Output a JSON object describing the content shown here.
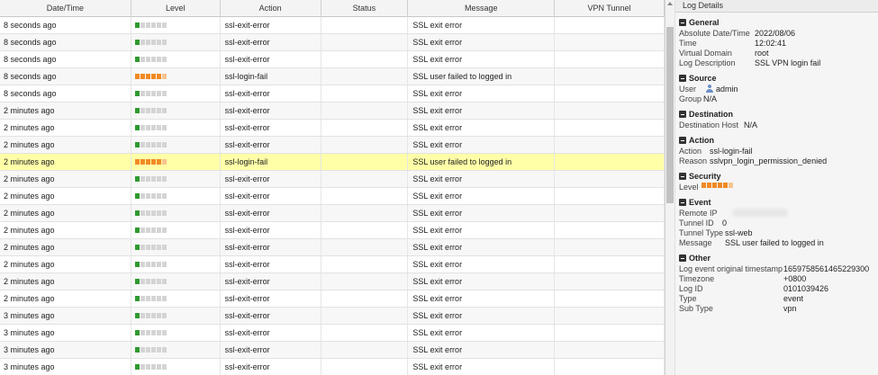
{
  "table": {
    "columns": [
      "Date/Time",
      "Level",
      "Action",
      "Status",
      "Message",
      "VPN Tunnel"
    ],
    "rows": [
      {
        "time": "8 seconds ago",
        "level": "info",
        "action": "ssl-exit-error",
        "status": "",
        "message": "SSL exit error",
        "tunnel": ""
      },
      {
        "time": "8 seconds ago",
        "level": "info",
        "action": "ssl-exit-error",
        "status": "",
        "message": "SSL exit error",
        "tunnel": ""
      },
      {
        "time": "8 seconds ago",
        "level": "info",
        "action": "ssl-exit-error",
        "status": "",
        "message": "SSL exit error",
        "tunnel": ""
      },
      {
        "time": "8 seconds ago",
        "level": "alert",
        "action": "ssl-login-fail",
        "status": "",
        "message": "SSL user failed to logged in",
        "tunnel": ""
      },
      {
        "time": "8 seconds ago",
        "level": "info",
        "action": "ssl-exit-error",
        "status": "",
        "message": "SSL exit error",
        "tunnel": ""
      },
      {
        "time": "2 minutes ago",
        "level": "info",
        "action": "ssl-exit-error",
        "status": "",
        "message": "SSL exit error",
        "tunnel": ""
      },
      {
        "time": "2 minutes ago",
        "level": "info",
        "action": "ssl-exit-error",
        "status": "",
        "message": "SSL exit error",
        "tunnel": ""
      },
      {
        "time": "2 minutes ago",
        "level": "info",
        "action": "ssl-exit-error",
        "status": "",
        "message": "SSL exit error",
        "tunnel": ""
      },
      {
        "time": "2 minutes ago",
        "level": "alert",
        "action": "ssl-login-fail",
        "status": "",
        "message": "SSL user failed to logged in",
        "tunnel": "",
        "selected": true
      },
      {
        "time": "2 minutes ago",
        "level": "info",
        "action": "ssl-exit-error",
        "status": "",
        "message": "SSL exit error",
        "tunnel": ""
      },
      {
        "time": "2 minutes ago",
        "level": "info",
        "action": "ssl-exit-error",
        "status": "",
        "message": "SSL exit error",
        "tunnel": ""
      },
      {
        "time": "2 minutes ago",
        "level": "info",
        "action": "ssl-exit-error",
        "status": "",
        "message": "SSL exit error",
        "tunnel": ""
      },
      {
        "time": "2 minutes ago",
        "level": "info",
        "action": "ssl-exit-error",
        "status": "",
        "message": "SSL exit error",
        "tunnel": ""
      },
      {
        "time": "2 minutes ago",
        "level": "info",
        "action": "ssl-exit-error",
        "status": "",
        "message": "SSL exit error",
        "tunnel": ""
      },
      {
        "time": "2 minutes ago",
        "level": "info",
        "action": "ssl-exit-error",
        "status": "",
        "message": "SSL exit error",
        "tunnel": ""
      },
      {
        "time": "2 minutes ago",
        "level": "info",
        "action": "ssl-exit-error",
        "status": "",
        "message": "SSL exit error",
        "tunnel": ""
      },
      {
        "time": "2 minutes ago",
        "level": "info",
        "action": "ssl-exit-error",
        "status": "",
        "message": "SSL exit error",
        "tunnel": ""
      },
      {
        "time": "3 minutes ago",
        "level": "info",
        "action": "ssl-exit-error",
        "status": "",
        "message": "SSL exit error",
        "tunnel": ""
      },
      {
        "time": "3 minutes ago",
        "level": "info",
        "action": "ssl-exit-error",
        "status": "",
        "message": "SSL exit error",
        "tunnel": ""
      },
      {
        "time": "3 minutes ago",
        "level": "info",
        "action": "ssl-exit-error",
        "status": "",
        "message": "SSL exit error",
        "tunnel": ""
      },
      {
        "time": "3 minutes ago",
        "level": "info",
        "action": "ssl-exit-error",
        "status": "",
        "message": "SSL exit error",
        "tunnel": ""
      }
    ]
  },
  "details": {
    "title": "Log Details",
    "general": {
      "heading": "General",
      "absolute_date_time_label": "Absolute Date/Time",
      "absolute_date_time": "2022/08/06",
      "time_label": "Time",
      "time": "12:02:41",
      "virtual_domain_label": "Virtual Domain",
      "virtual_domain": "root",
      "log_description_label": "Log Description",
      "log_description": "SSL VPN login fail"
    },
    "source": {
      "heading": "Source",
      "user_label": "User",
      "user": "admin",
      "group_label": "Group",
      "group": "N/A"
    },
    "destination": {
      "heading": "Destination",
      "host_label": "Destination Host",
      "host": "N/A"
    },
    "action": {
      "heading": "Action",
      "action_label": "Action",
      "action": "ssl-login-fail",
      "reason_label": "Reason",
      "reason": "sslvpn_login_permission_denied"
    },
    "security": {
      "heading": "Security",
      "level_label": "Level",
      "level": "alert"
    },
    "event": {
      "heading": "Event",
      "remote_ip_label": "Remote IP",
      "tunnel_id_label": "Tunnel ID",
      "tunnel_id": "0",
      "tunnel_type_label": "Tunnel Type",
      "tunnel_type": "ssl-web",
      "message_label": "Message",
      "message": "SSL user failed to logged in"
    },
    "other": {
      "heading": "Other",
      "orig_ts_label": "Log event original timestamp",
      "orig_ts": "1659758561465229300",
      "timezone_label": "Timezone",
      "timezone": "+0800",
      "log_id_label": "Log ID",
      "log_id": "0101039426",
      "type_label": "Type",
      "type": "event",
      "sub_type_label": "Sub Type",
      "sub_type": "vpn"
    }
  },
  "colors": {
    "selected_row": "#ffffa8",
    "level_info": "#2f9a2f",
    "level_alert": "#f08a24"
  }
}
